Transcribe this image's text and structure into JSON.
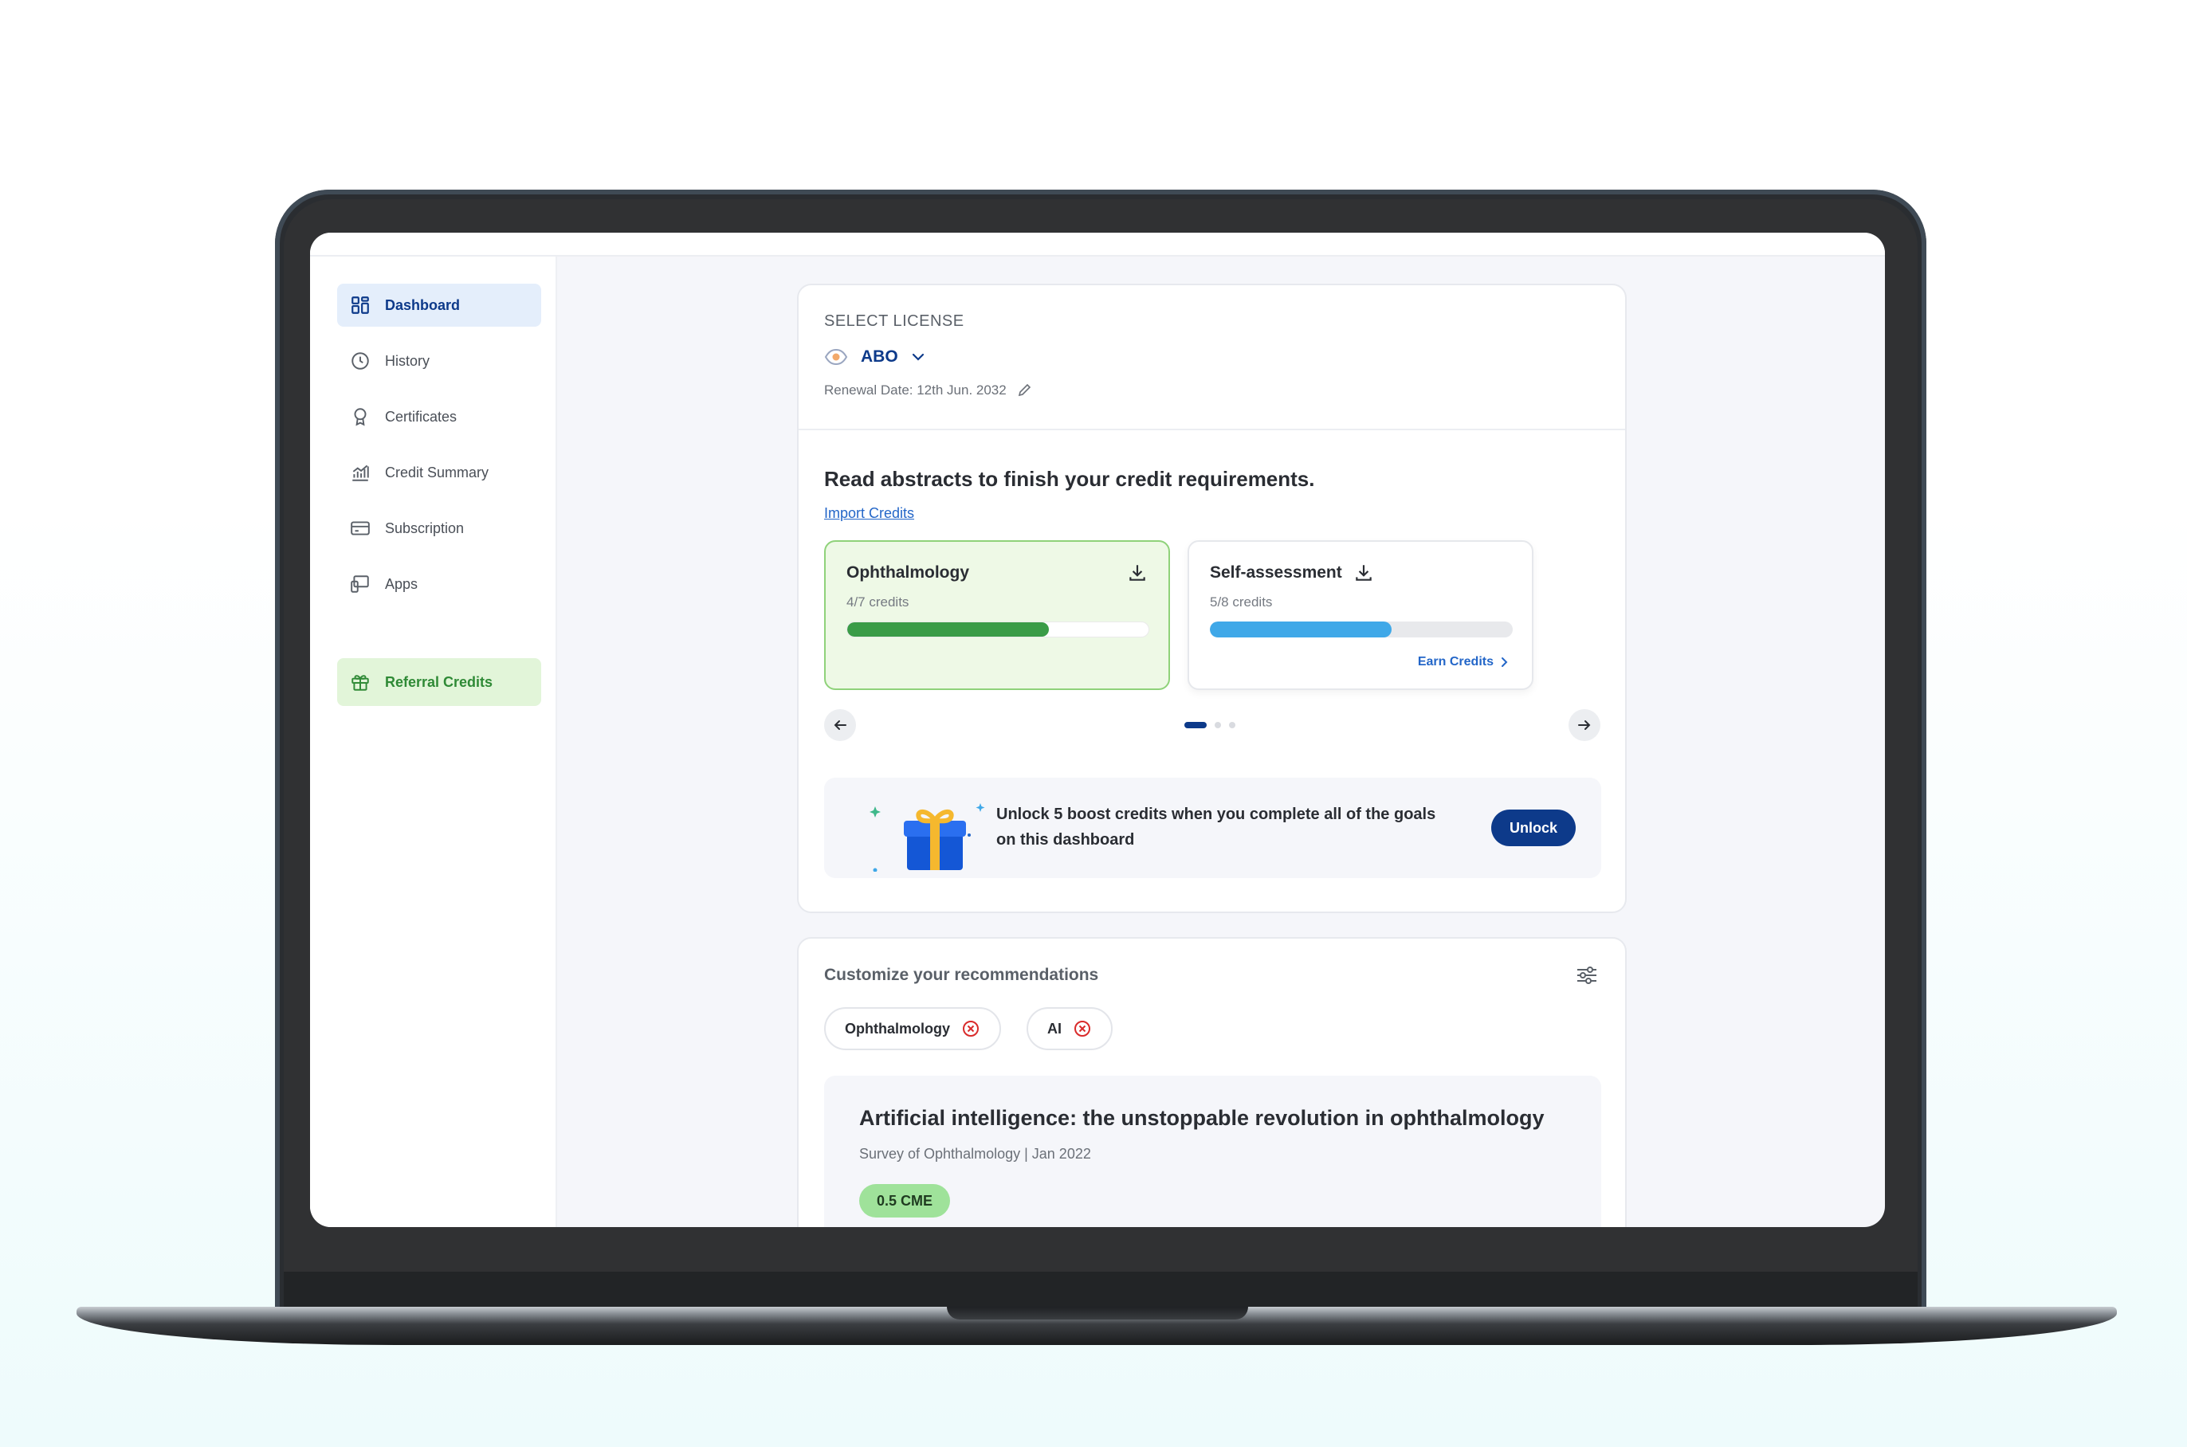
{
  "sidebar": {
    "items": [
      {
        "label": "Dashboard",
        "icon": "dashboard-icon"
      },
      {
        "label": "History",
        "icon": "clock-icon"
      },
      {
        "label": "Certificates",
        "icon": "award-icon"
      },
      {
        "label": "Credit Summary",
        "icon": "bar-chart-icon"
      },
      {
        "label": "Subscription",
        "icon": "credit-card-icon"
      },
      {
        "label": "Apps",
        "icon": "devices-icon"
      }
    ],
    "referral": {
      "label": "Referral Credits",
      "icon": "gift-icon"
    }
  },
  "license": {
    "section_label": "SELECT LICENSE",
    "selected": "ABO",
    "renewal": "Renewal Date: 12th Jun. 2032"
  },
  "credits": {
    "headline": "Read abstracts to finish your credit requirements.",
    "import_link": "Import Credits",
    "cards": [
      {
        "title": "Ophthalmology",
        "subtitle": "4/7 credits",
        "progress": 0.67
      },
      {
        "title": "Self-assessment",
        "subtitle": "5/8 credits",
        "progress": 0.6,
        "action": "Earn Credits"
      }
    ]
  },
  "boost": {
    "text": "Unlock 5 boost credits when you complete all of the goals on this dashboard",
    "button": "Unlock"
  },
  "recommendations": {
    "title": "Customize your recommendations",
    "chips": [
      "Ophthalmology",
      "AI"
    ],
    "article": {
      "title": "Artificial intelligence: the unstoppable revolution in ophthalmology",
      "meta": "Survey of Ophthalmology | Jan 2022",
      "badge": "0.5 CME"
    }
  },
  "colors": {
    "brand": "#0d3a8a",
    "green_progress": "#3a9c47",
    "blue_progress": "#3fa8e8",
    "link": "#2366c8"
  }
}
